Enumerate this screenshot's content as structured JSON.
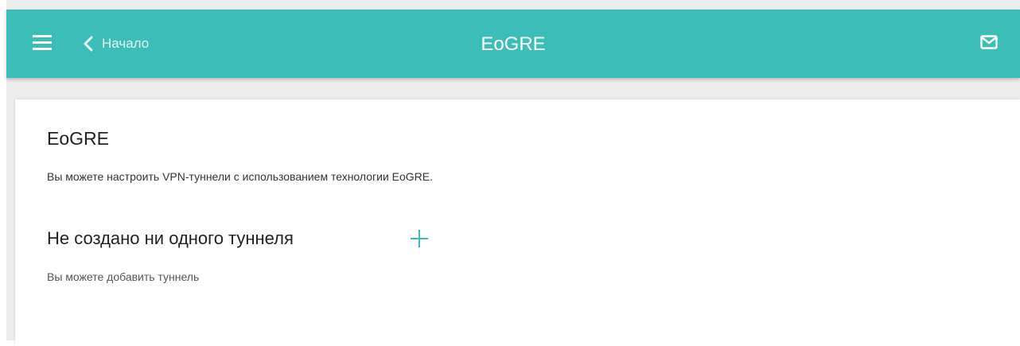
{
  "header": {
    "menu_icon": "hamburger-menu-icon",
    "back_icon": "chevron-left-icon",
    "back_label": "Начало",
    "title": "EoGRE",
    "mail_icon": "envelope-icon"
  },
  "main": {
    "title": "EoGRE",
    "description": "Вы можете настроить VPN-туннели с использованием технологии EoGRE.",
    "tunnels": {
      "empty_title": "Не создано ни одного туннеля",
      "add_icon": "plus-icon",
      "empty_hint": "Вы можете добавить туннель"
    }
  },
  "colors": {
    "header_bg": "#3dbdb8",
    "accent": "#3dbdb8",
    "page_bg": "#ececec",
    "card_bg": "#ffffff"
  }
}
